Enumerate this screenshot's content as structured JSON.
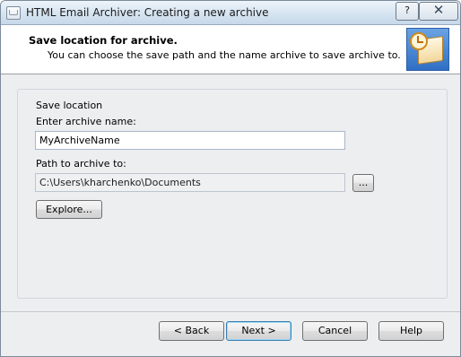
{
  "window": {
    "title": "HTML Email Archiver: Creating a new archive"
  },
  "titlebar_buttons": {
    "help": "?",
    "close": "✕"
  },
  "header": {
    "title": "Save location for archive.",
    "subtitle": "You can choose the save path and the name archive to save archive to."
  },
  "form": {
    "group_label": "Save location",
    "name_label": "Enter archive name:",
    "name_value": "MyArchiveName",
    "path_label": "Path to archive to:",
    "path_value": "C:\\Users\\kharchenko\\Documents",
    "browse_label": "...",
    "explore_label": "Explore..."
  },
  "buttons": {
    "back": "< Back",
    "next": "Next >",
    "cancel": "Cancel",
    "help": "Help"
  }
}
